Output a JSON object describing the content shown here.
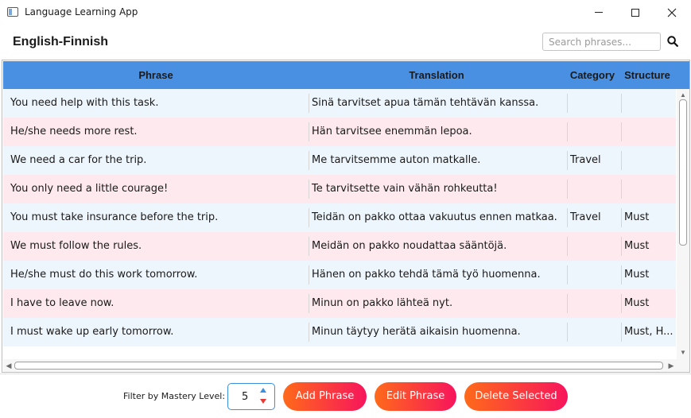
{
  "window": {
    "title": "Language Learning App"
  },
  "header": {
    "title": "English-Finnish",
    "search_placeholder": "Search phrases..."
  },
  "table": {
    "columns": [
      "Phrase",
      "Translation",
      "Category",
      "Structure"
    ],
    "rows": [
      {
        "phrase": "You need help with this task.",
        "translation": "Sinä tarvitset apua tämän tehtävän kanssa.",
        "category": "",
        "structure": ""
      },
      {
        "phrase": "He/she needs more rest.",
        "translation": "Hän tarvitsee enemmän lepoa.",
        "category": "",
        "structure": ""
      },
      {
        "phrase": "We need a car for the trip.",
        "translation": "Me tarvitsemme auton matkalle.",
        "category": "Travel",
        "structure": ""
      },
      {
        "phrase": "You only need a little courage!",
        "translation": "Te tarvitsette vain vähän rohkeutta!",
        "category": "",
        "structure": ""
      },
      {
        "phrase": "You must take insurance before the trip.",
        "translation": "Teidän on pakko ottaa vakuutus ennen matkaa.",
        "category": "Travel",
        "structure": "Must"
      },
      {
        "phrase": "We must follow the rules.",
        "translation": "Meidän on pakko noudattaa sääntöjä.",
        "category": "",
        "structure": "Must"
      },
      {
        "phrase": "He/she must do this work tomorrow.",
        "translation": "Hänen on pakko tehdä tämä työ huomenna.",
        "category": "",
        "structure": "Must"
      },
      {
        "phrase": "I have to leave now.",
        "translation": "Minun on pakko lähteä nyt.",
        "category": "",
        "structure": "Must"
      },
      {
        "phrase": "I must wake up early tomorrow.",
        "translation": "Minun täytyy herätä aikaisin huomenna.",
        "category": "",
        "structure": "Must, H..."
      }
    ]
  },
  "footer": {
    "filter_label": "Filter by Mastery Level:",
    "mastery_value": "5",
    "add_label": "Add Phrase",
    "edit_label": "Edit Phrase",
    "delete_label": "Delete Selected"
  },
  "colors": {
    "header_bg": "#4a90e2",
    "row_even": "#eef6fd",
    "row_odd": "#fde9ee",
    "button_gradient_start": "#ff6a1a",
    "button_gradient_end": "#f7155c"
  }
}
